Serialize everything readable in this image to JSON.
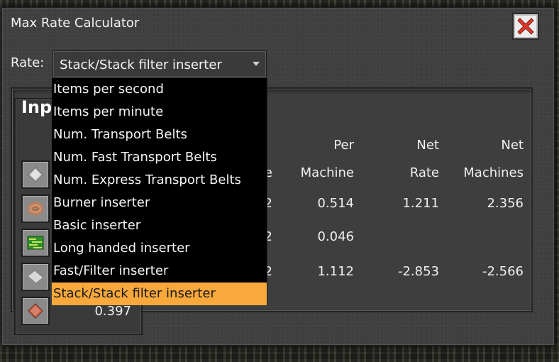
{
  "window": {
    "title": "Max Rate Calculator"
  },
  "rate": {
    "label": "Rate:",
    "selected": "Stack/Stack filter inserter",
    "options": [
      "Items per second",
      "Items per minute",
      "Num. Transport Belts",
      "Num. Fast Transport Belts",
      "Num. Express Transport Belts",
      "Burner inserter",
      "Basic inserter",
      "Long handed inserter",
      "Fast/Filter inserter",
      "Stack/Stack filter inserter"
    ]
  },
  "inputs": {
    "heading": "Inp",
    "items": [
      {
        "icon": "iron-plate-icon"
      },
      {
        "icon": "copper-cable-icon"
      },
      {
        "icon": "electronic-circuit-icon"
      },
      {
        "icon": "steel-plate-icon"
      },
      {
        "icon": "copper-plate-icon",
        "value": "0.397"
      }
    ]
  },
  "table": {
    "headers": {
      "rate_partial": "e",
      "per_machine_line1": "Per",
      "per_machine_line2": "Machine",
      "net_rate_line1": "Net",
      "net_rate_line2": "Rate",
      "net_machines_line1": "Net",
      "net_machines_line2": "Machines"
    },
    "rows": [
      {
        "rate_partial": "2",
        "per_machine": "0.514",
        "net_rate": "1.211",
        "net_machines": "2.356"
      },
      {
        "rate_partial": "2",
        "per_machine": "0.046",
        "net_rate": "",
        "net_machines": ""
      },
      {
        "rate_partial": "2",
        "per_machine": "1.112",
        "net_rate": "-2.853",
        "net_machines": "-2.566"
      }
    ]
  },
  "colors": {
    "highlight": "#f9a83c",
    "close_red": "#e23b2b",
    "panel": "#404040"
  }
}
